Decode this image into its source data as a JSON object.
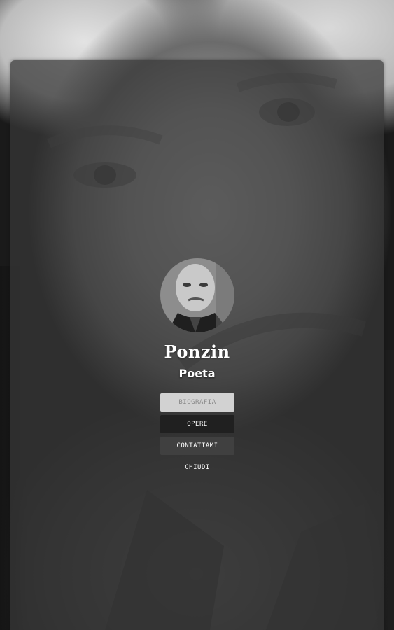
{
  "profile": {
    "name": "Ponzin",
    "role": "Poeta",
    "avatar_icon": "portrait-photo"
  },
  "menu": {
    "items": [
      {
        "label": "BIOGRAFIA",
        "state": "selected"
      },
      {
        "label": "OPERE",
        "state": "normal"
      },
      {
        "label": "CONTATTAMI",
        "state": "normal"
      },
      {
        "label": "CHIUDI",
        "state": "text"
      }
    ]
  },
  "colors": {
    "overlay": "#373737",
    "button_selected": "#d2d2d2",
    "button_dark": "#202020",
    "button_mid": "#404040",
    "text": "#ffffff"
  }
}
